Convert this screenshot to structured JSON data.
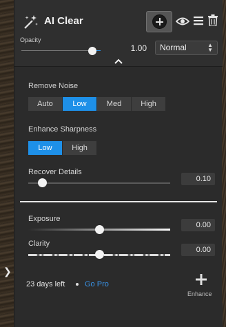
{
  "header": {
    "title": "AI Clear",
    "opacity_label": "Opacity",
    "opacity_value_text": "1.00",
    "opacity_level": 1.0,
    "blend_mode": "Normal",
    "icons": [
      "magic-wand-icon",
      "add-circle-icon",
      "eye-icon",
      "menu-icon",
      "trash-icon",
      "chevron-up-icon"
    ]
  },
  "remove_noise": {
    "label": "Remove Noise",
    "options": [
      "Auto",
      "Low",
      "Med",
      "High"
    ],
    "selected": "Low"
  },
  "enhance_sharpness": {
    "label": "Enhance Sharpness",
    "options": [
      "Low",
      "High"
    ],
    "selected": "Low"
  },
  "recover_details": {
    "label": "Recover Details",
    "value": "0.10",
    "level": 0.1
  },
  "exposure": {
    "label": "Exposure",
    "value": "0.00",
    "level": 0.5
  },
  "clarity": {
    "label": "Clarity",
    "value": "0.00",
    "level": 0.5
  },
  "footer": {
    "trial_text": "23 days left",
    "go_pro": "Go Pro",
    "enhance_label": "Enhance"
  },
  "colors": {
    "accent": "#1e90e8",
    "link": "#3a95ea",
    "panel_bg": "#2b2b2b"
  }
}
